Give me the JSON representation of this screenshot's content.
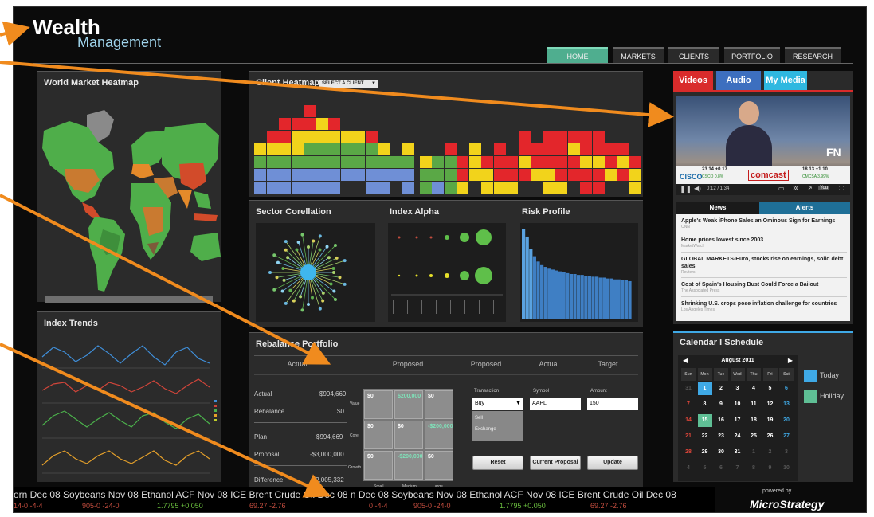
{
  "header": {
    "logo_main": "Wealth",
    "logo_sub": "Management"
  },
  "nav": [
    {
      "label": "HOME",
      "active": true
    },
    {
      "label": "MARKETS",
      "active": false
    },
    {
      "label": "CLIENTS",
      "active": false
    },
    {
      "label": "PORTFOLIO",
      "active": false
    },
    {
      "label": "RESEARCH",
      "active": false
    }
  ],
  "panels": {
    "world_heatmap": "World Market Heatmap",
    "index_trends": "Index Trends",
    "client_heatmap": "Client Heatmap",
    "select_client": "SELECT A CLIENT",
    "sector_correlation": "Sector Corellation",
    "index_alpha": "Index Alpha",
    "risk_profile": "Risk Profile",
    "rebalance": "Rebalance Portfolio",
    "calendar": "Calendar I Schedule"
  },
  "media_tabs": [
    "Videos",
    "Audio",
    "My Media"
  ],
  "video": {
    "time": "0:12 / 1:34",
    "ticker_a": "23.14 +0.17",
    "ticker_b": "CSCO 0.8%",
    "ticker_c": "18.13 +1.10",
    "ticker_d": "CMCSA 3.99%",
    "brand_a": "CISCO",
    "brand_b": "comcast",
    "logo": "FN"
  },
  "news_tabs": [
    "News",
    "Alerts"
  ],
  "news": [
    {
      "headline": "Apple's Weak iPhone Sales an Ominous Sign for Earnings",
      "source": "CNN"
    },
    {
      "headline": "Home prices lowest since 2003",
      "source": "MarketWatch"
    },
    {
      "headline": "GLOBAL MARKETS-Euro, stocks rise on earnings, solid debt sales",
      "source": "Reuters"
    },
    {
      "headline": "Cost of Spain's Housing Bust Could Force a Bailout",
      "source": "The Associated Press"
    },
    {
      "headline": "Shrinking U.S. crops pose inflation challenge for countries",
      "source": "Los Angeles Times"
    }
  ],
  "rebalance": {
    "headers": [
      "Actual",
      "Proposed",
      "Proposed",
      "Actual",
      "Target"
    ],
    "rows": [
      {
        "label": "Actual",
        "value": "$994,669"
      },
      {
        "label": "Rebalance",
        "value": "$0"
      },
      {
        "label": "Plan",
        "value": "$994,669"
      },
      {
        "label": "Proposal",
        "value": "-$3,000,000"
      },
      {
        "label": "Difference",
        "value": "-$2,005,332"
      }
    ],
    "matrix_rows": [
      "Value",
      "Core",
      "Growth"
    ],
    "matrix_cols": [
      "Small",
      "Medium",
      "Large"
    ],
    "matrix": [
      [
        "$0",
        "$200,000",
        "$0"
      ],
      [
        "$0",
        "$0",
        "-$200,000"
      ],
      [
        "$0",
        "-$200,000",
        "$0"
      ]
    ],
    "transaction_label": "Transaction",
    "symbol_label": "Symbol",
    "amount_label": "Amount",
    "transaction_value": "Buy",
    "transaction_options": [
      "Sell",
      "Exchange"
    ],
    "symbol_value": "AAPL",
    "amount_value": "150",
    "buttons": [
      "Reset",
      "Current Proposal",
      "Update"
    ]
  },
  "calendar": {
    "month": "August 2011",
    "weekdays": [
      "Sun",
      "Mon",
      "Tue",
      "Wed",
      "Thu",
      "Fri",
      "Sat"
    ],
    "weeks": [
      [
        "31",
        "1",
        "2",
        "3",
        "4",
        "5",
        "6"
      ],
      [
        "7",
        "8",
        "9",
        "10",
        "11",
        "12",
        "13"
      ],
      [
        "14",
        "15",
        "16",
        "17",
        "18",
        "19",
        "20"
      ],
      [
        "21",
        "22",
        "23",
        "24",
        "25",
        "26",
        "27"
      ],
      [
        "28",
        "29",
        "30",
        "31",
        "1",
        "2",
        "3"
      ],
      [
        "4",
        "5",
        "6",
        "7",
        "8",
        "9",
        "10"
      ]
    ],
    "today": "1",
    "holiday": "15",
    "legend": [
      "Today",
      "Holiday"
    ],
    "colors": {
      "today": "#3fa9e6",
      "holiday": "#5fbf95"
    }
  },
  "ticker": {
    "line1": "orn Dec 08  Soybeans Nov 08  Ethanol ACF Nov 08  ICE Brent Crude Oil Dec 08  n Dec 08  Soybeans Nov 08  Ethanol ACF Nov 08  ICE Brent Crude Oil Dec 08",
    "quotes": [
      {
        "text": "14-0 -4-4",
        "tone": "down"
      },
      {
        "text": "905-0 -24-0",
        "tone": "down"
      },
      {
        "text": "1.7795 +0.050",
        "tone": "up"
      },
      {
        "text": "69.27 -2.76",
        "tone": "down"
      },
      {
        "text": "0 -4-4",
        "tone": "down"
      },
      {
        "text": "905-0 -24-0",
        "tone": "down"
      },
      {
        "text": "1.7795 +0.050",
        "tone": "up"
      },
      {
        "text": "69.27 -2.76",
        "tone": "down"
      }
    ]
  },
  "powered": {
    "by": "powered by",
    "brand": "MicroStrategy"
  },
  "colors": {
    "accent": "#4fae8f",
    "videos_tab": "#d92b2b",
    "audio_tab": "#3d6fbf",
    "mymedia_tab": "#2fb8e0",
    "heat": [
      "#e3262b",
      "#f2d31b",
      "#5aa846",
      "#6f8fd6"
    ]
  }
}
